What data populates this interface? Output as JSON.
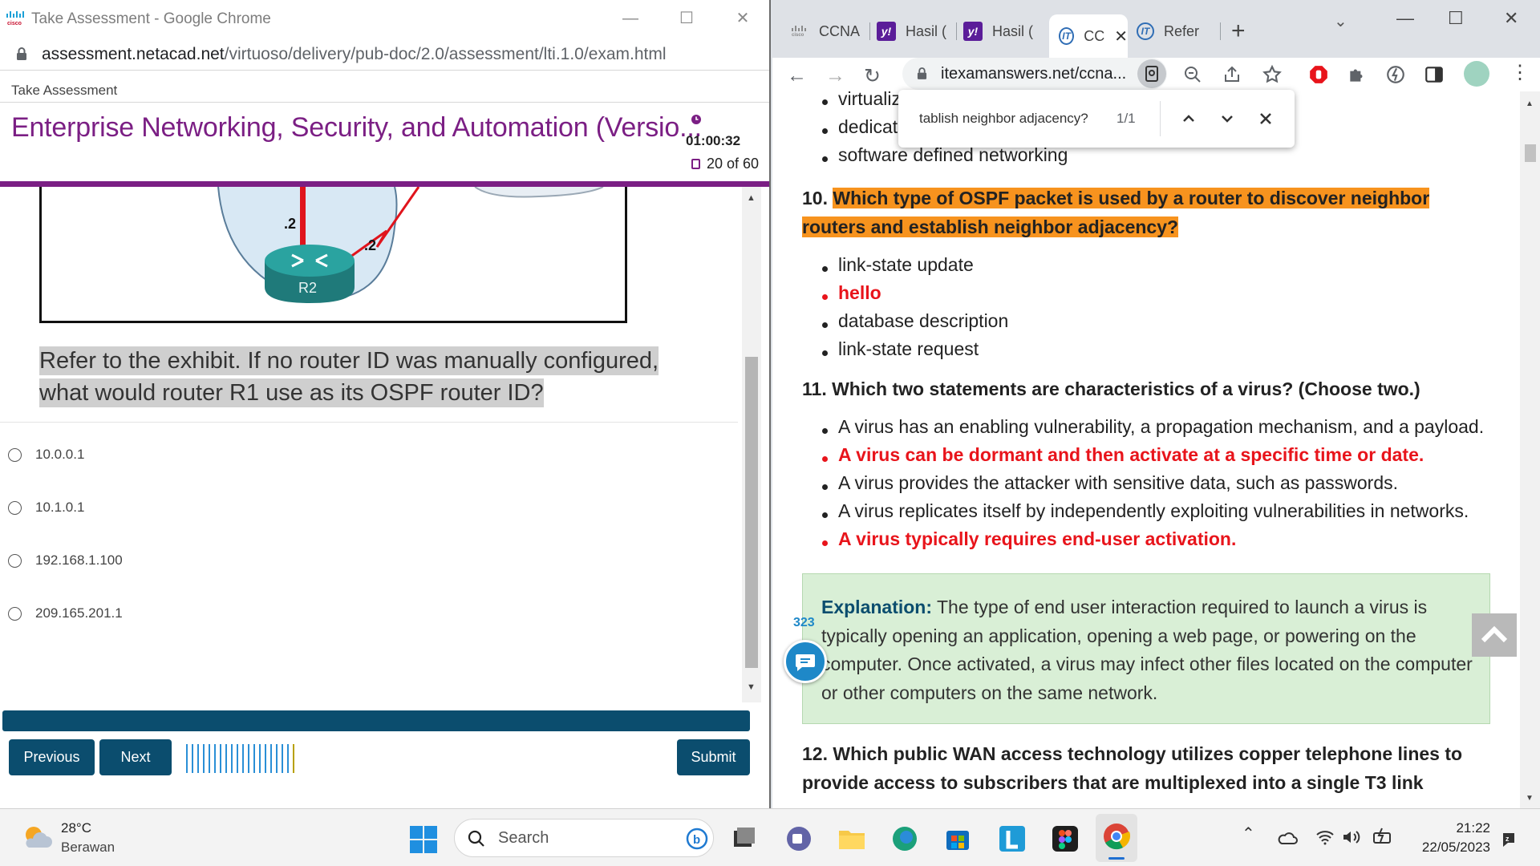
{
  "left_window": {
    "title": "Take Assessment - Google Chrome",
    "url_domain": "assessment.netacad.net",
    "url_path": "/virtuoso/delivery/pub-doc/2.0/assessment/lti.1.0/exam.html",
    "app_header": "Take Assessment",
    "course_title": "Enterprise Networking, Security, and Automation (Versio...",
    "timer": "01:00:32",
    "question_count": "20 of 60",
    "exhibit": {
      "router_label": "R2",
      "link_label_1": ".2",
      "link_label_2": ".2"
    },
    "question_text": "Refer to the exhibit. If no router ID was manually configured, what would router R1 use as its OSPF router ID?",
    "options": [
      "10.0.0.1",
      "10.1.0.1",
      "192.168.1.100",
      "209.165.201.1"
    ],
    "buttons": {
      "previous": "Previous",
      "next": "Next",
      "submit": "Submit"
    },
    "progress": {
      "total_ticks": 20,
      "current_tick": 20
    }
  },
  "right_window": {
    "tabs": [
      {
        "label": "CCNA",
        "icon": "cisco-icon"
      },
      {
        "label": "Hasil (",
        "icon": "yahoo-icon"
      },
      {
        "label": "Hasil (",
        "icon": "yahoo-icon"
      },
      {
        "label": "CC",
        "icon": "itexam-icon",
        "active": true
      },
      {
        "label": "Refer",
        "icon": "itexam-icon"
      }
    ],
    "url": "itexamanswers.net/ccna...",
    "find": {
      "query": "tablish neighbor adjacency?",
      "count": "1/1"
    },
    "prev_items": [
      "virtualiz",
      "dedicate",
      "software defined networking"
    ],
    "q10": {
      "number": "10.",
      "line1": "Which type of OSPF packet is used by a router to discover neighbor",
      "line2": "routers and establish neighbor adjacency?",
      "options": [
        {
          "text": "link-state update",
          "correct": false
        },
        {
          "text": "hello",
          "correct": true
        },
        {
          "text": "database description",
          "correct": false
        },
        {
          "text": "link-state request",
          "correct": false
        }
      ]
    },
    "q11": {
      "text": "11. Which two statements are characteristics of a virus? (Choose two.)",
      "options": [
        {
          "text": "A virus has an enabling vulnerability, a propagation mechanism, and a payload.",
          "correct": false
        },
        {
          "text": "A virus can be dormant and then activate at a specific time or date.",
          "correct": true
        },
        {
          "text": "A virus provides the attacker with sensitive data, such as passwords.",
          "correct": false
        },
        {
          "text": "A virus replicates itself by independently exploiting vulnerabilities in networks.",
          "correct": false
        },
        {
          "text": "A virus typically requires end-user activation.",
          "correct": true
        }
      ]
    },
    "explanation": {
      "label": "Explanation:",
      "text": " The type of end user interaction required to launch a virus is typically opening an application, opening a web page, or powering on the computer. Once activated, a virus may infect other files located on the computer or other computers on the same network."
    },
    "comment_count": "323",
    "q12": {
      "line1": "12. Which public WAN access technology utilizes copper telephone lines to",
      "line2": "provide access to subscribers that are multiplexed into a single T3 link"
    }
  },
  "taskbar": {
    "weather": {
      "temp": "28°C",
      "condition": "Berawan"
    },
    "search_placeholder": "Search",
    "time": "21:22",
    "date": "22/05/2023"
  },
  "colors": {
    "netacad_purple": "#7b1f84",
    "netacad_blue": "#0b4d6e",
    "highlight_orange": "#f7931e",
    "answer_red": "#e8141b",
    "explanation_green": "#d9efd6"
  }
}
